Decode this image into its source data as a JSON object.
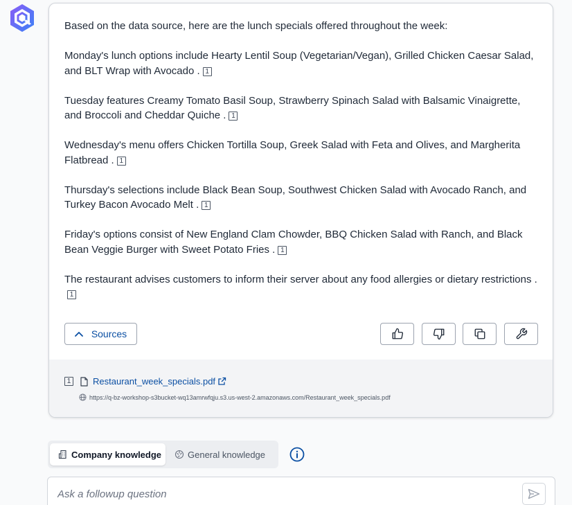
{
  "answer": {
    "intro": "Based on the data source, here are the lunch specials offered throughout the week:",
    "paragraphs": [
      {
        "text": "Monday's lunch options include Hearty Lentil Soup (Vegetarian/Vegan), Grilled Chicken Caesar Salad, and BLT Wrap with Avocado .",
        "cite": "1"
      },
      {
        "text": "Tuesday features Creamy Tomato Basil Soup, Strawberry Spinach Salad with Balsamic Vinaigrette, and Broccoli and Cheddar Quiche .",
        "cite": "1"
      },
      {
        "text": "Wednesday's menu offers Chicken Tortilla Soup, Greek Salad with Feta and Olives, and Margherita Flatbread .",
        "cite": "1"
      },
      {
        "text": "Thursday's selections include Black Bean Soup, Southwest Chicken Salad with Avocado Ranch, and Turkey Bacon Avocado Melt .",
        "cite": "1"
      },
      {
        "text": "Friday's options consist of New England Clam Chowder, BBQ Chicken Salad with Ranch, and Black Bean Veggie Burger with Sweet Potato Fries .",
        "cite": "1"
      },
      {
        "text": "The restaurant advises customers to inform their server about any food allergies or dietary restrictions .",
        "cite": "1"
      }
    ]
  },
  "actions": {
    "sources_label": "Sources",
    "icons": [
      "thumbs-up-icon",
      "thumbs-down-icon",
      "copy-icon",
      "wrench-icon"
    ]
  },
  "sources": [
    {
      "num": "1",
      "title": "Restaurant_week_specials.pdf",
      "url": "https://q-bz-workshop-s3bucket-wq13amrwfqju.s3.us-west-2.amazonaws.com/Restaurant_week_specials.pdf"
    }
  ],
  "knowledge_toggle": {
    "company_label": "Company knowledge",
    "general_label": "General knowledge",
    "selected": "company"
  },
  "followup": {
    "placeholder": "Ask a followup question"
  },
  "colors": {
    "accent": "#0b4fa3",
    "logo_gradient_start": "#7c3aed",
    "logo_gradient_end": "#3b82f6"
  }
}
